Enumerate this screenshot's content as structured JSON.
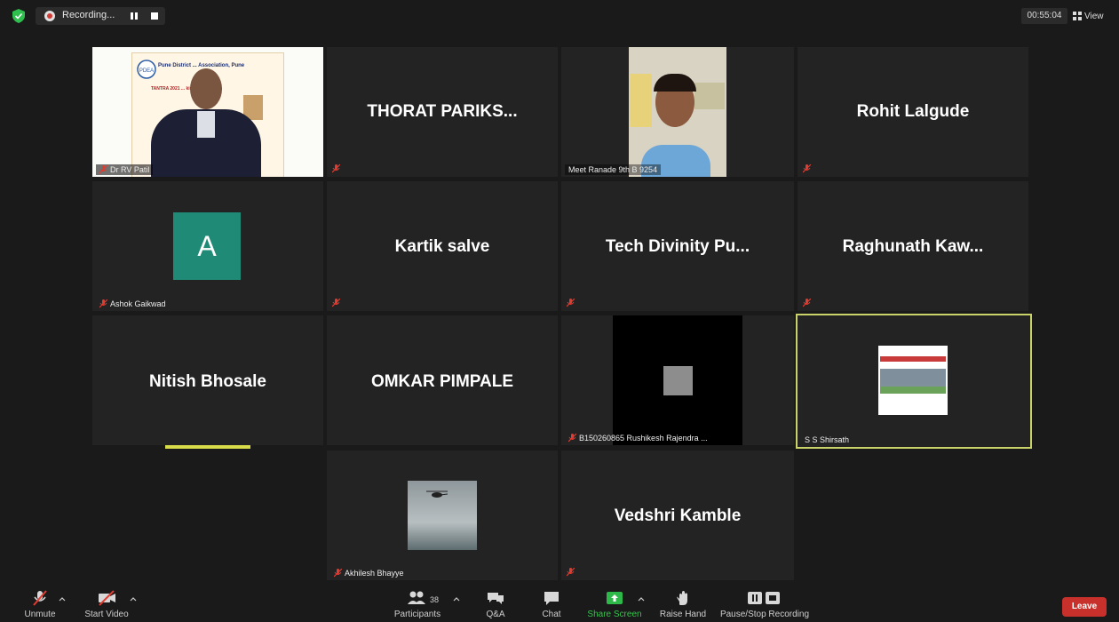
{
  "topbar": {
    "recording_label": "Recording...",
    "timer": "00:55:04",
    "view_label": "View"
  },
  "tiles": {
    "t1": {
      "label": "Dr RV Patil",
      "doc_heading": "Pune District ... Association, Pune",
      "doc_sub": "TANTRA 2021 ... king Competition"
    },
    "t2": {
      "name": "THORAT PARIKS..."
    },
    "t3": {
      "label": "Meet Ranade 9th B 9254"
    },
    "t4": {
      "name": "Rohit Lalgude"
    },
    "t5": {
      "avatar_letter": "A",
      "label": "Ashok Gaikwad"
    },
    "t6": {
      "name": "Kartik salve"
    },
    "t7": {
      "name": "Tech Divinity Pu..."
    },
    "t8": {
      "name": "Raghunath Kaw..."
    },
    "t9": {
      "name": "Nitish Bhosale"
    },
    "t10": {
      "name": "OMKAR PIMPALE"
    },
    "t11": {
      "label": "B150260865 Rushikesh Rajendra ..."
    },
    "t12": {
      "label": "S S Shirsath"
    },
    "t13": {
      "label": "Akhilesh Bhayye"
    },
    "t14": {
      "name": "Vedshri Kamble"
    }
  },
  "toolbar": {
    "unmute": "Unmute",
    "start_video": "Start Video",
    "participants": "Participants",
    "participants_count": "38",
    "qa": "Q&A",
    "chat": "Chat",
    "share_screen": "Share Screen",
    "raise_hand": "Raise Hand",
    "pause_stop": "Pause/Stop Recording",
    "leave": "Leave"
  },
  "colors": {
    "accent_green": "#37c24d",
    "leave_red": "#c8312b",
    "speaker_outline": "#c9d36a",
    "avatar_teal": "#1f8a76"
  }
}
